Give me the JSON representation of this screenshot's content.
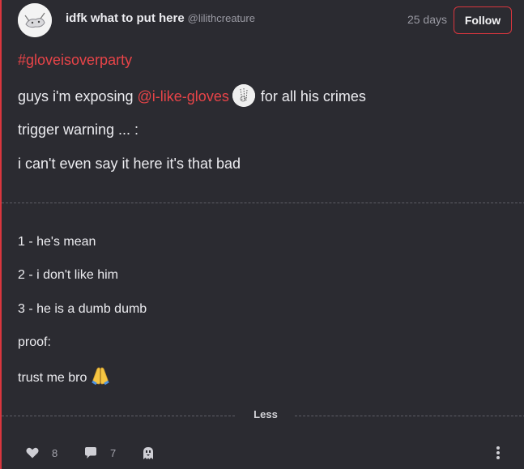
{
  "author": {
    "name": "idfk what to put here",
    "handle": "@lilithcreature",
    "age": "25 days",
    "follow_label": "Follow"
  },
  "post": {
    "hashtag": "#gloveisoverparty",
    "intro_prefix": "guys i'm exposing",
    "mention": "@i-like-gloves",
    "intro_suffix": "for all his crimes",
    "trigger_warning": "trigger warning ... :",
    "too_bad": "i can't even say it here it's that bad",
    "crimes": [
      "1 - he's mean",
      "2 - i don't like him",
      "3 - he is a dumb dumb"
    ],
    "proof_label": "proof:",
    "trust": "trust me bro"
  },
  "less_label": "Less",
  "actions": {
    "likes": "8",
    "comments": "7"
  },
  "colors": {
    "accent": "#e84448",
    "background": "#2b2b31",
    "text": "#ececf0"
  },
  "icons": {
    "like": "heart-icon",
    "comment": "comment-icon",
    "ghost": "ghost-icon",
    "more": "more-vertical-icon",
    "emoji": "folded-hands-emoji"
  }
}
